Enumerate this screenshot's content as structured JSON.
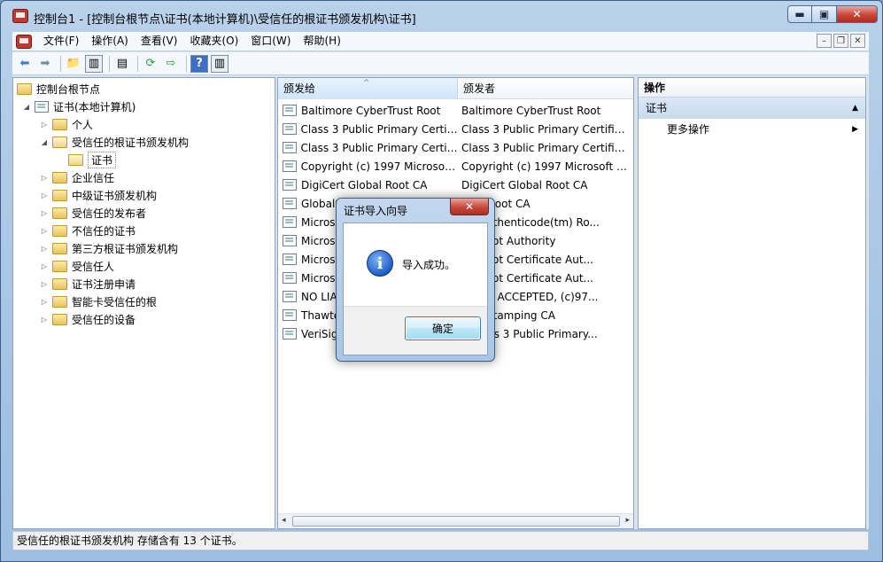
{
  "window": {
    "title": "控制台1 - [控制台根节点\\证书(本地计算机)\\受信任的根证书颁发机构\\证书]",
    "min_icon": "▬",
    "max_icon": "▣",
    "close_icon": "✕"
  },
  "menubar": {
    "items": [
      "文件(F)",
      "操作(A)",
      "查看(V)",
      "收藏夹(O)",
      "窗口(W)",
      "帮助(H)"
    ],
    "mdi_min": "–",
    "mdi_max": "❐",
    "mdi_close": "✕"
  },
  "toolbar": {
    "icons": [
      "back-arrow-icon",
      "forward-arrow-icon",
      "up-folder-icon",
      "show-hide-tree-icon",
      "properties-icon",
      "refresh-icon",
      "export-list-icon",
      "help-icon",
      "show-hide-action-icon"
    ],
    "glyphs": {
      "back": "⬅",
      "forward": "➡",
      "up": "📁",
      "tree": "▥",
      "props": "▤",
      "refresh": "⟳",
      "export": "⇨",
      "help": "?",
      "action": "▥"
    }
  },
  "tree": {
    "root": "控制台根节点",
    "certs": "证书(本地计算机)",
    "nodes": [
      "个人",
      "受信任的根证书颁发机构",
      "证书",
      "企业信任",
      "中级证书颁发机构",
      "受信任的发布者",
      "不信任的证书",
      "第三方根证书颁发机构",
      "受信任人",
      "证书注册申请",
      "智能卡受信任的根",
      "受信任的设备"
    ],
    "expand_open": "◢",
    "expand_closed": "▷"
  },
  "list": {
    "columns": [
      "颁发给",
      "颁发者"
    ],
    "sort_indicator": "^",
    "rows": [
      [
        "Baltimore CyberTrust Root",
        "Baltimore CyberTrust Root"
      ],
      [
        "Class 3 Public Primary Certifi...",
        "Class 3 Public Primary Certifica..."
      ],
      [
        "Class 3 Public Primary Certifi...",
        "Class 3 Public Primary Certifica..."
      ],
      [
        "Copyright (c) 1997 Microsoft...",
        "Copyright (c) 1997 Microsoft C..."
      ],
      [
        "DigiCert Global Root CA",
        "DigiCert Global Root CA"
      ],
      [
        "GlobalS",
        "Sign Root CA"
      ],
      [
        "Microso",
        "oft Authenticode(tm) Ro..."
      ],
      [
        "Microso",
        "oft Root Authority"
      ],
      [
        "Microso",
        "oft Root Certificate Aut..."
      ],
      [
        "Microso",
        "oft Root Certificate Aut..."
      ],
      [
        "NO LIA",
        "BILITY ACCEPTED, (c)97..."
      ],
      [
        "Thawte",
        "Timestamping CA"
      ],
      [
        "VeriSign",
        "n Class 3 Public Primary..."
      ]
    ],
    "scroll_left": "◂",
    "scroll_right": "▸"
  },
  "actions": {
    "header": "操作",
    "section": "证书",
    "more": "更多操作",
    "section_caret": "▲",
    "more_caret": "▶"
  },
  "status": "受信任的根证书颁发机构 存储含有 13 个证书。",
  "dialog": {
    "title": "证书导入向导",
    "close": "✕",
    "icon_glyph": "i",
    "message": "导入成功。",
    "ok": "确定"
  }
}
